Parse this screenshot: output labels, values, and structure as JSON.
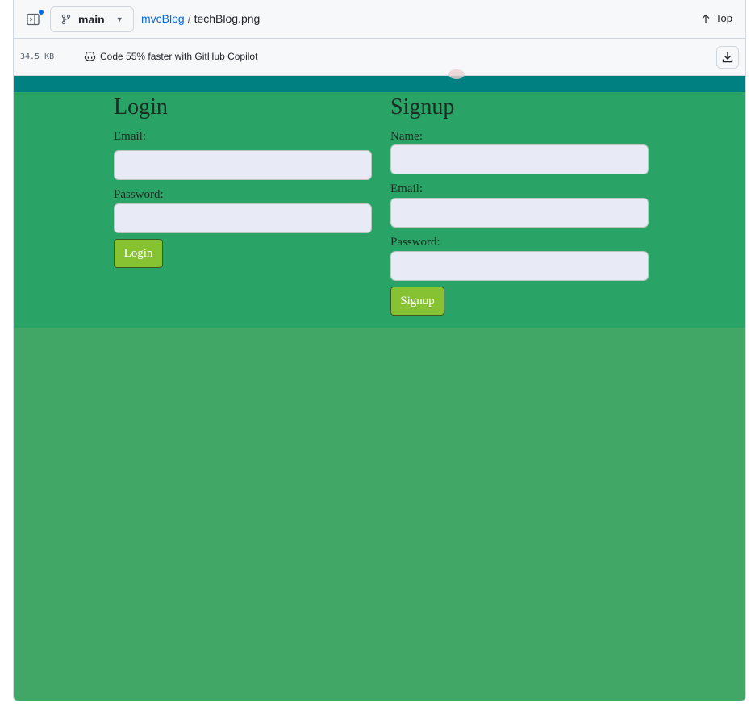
{
  "toolbar": {
    "branch": "main",
    "breadcrumb": {
      "repo": "mvcBlog",
      "separator": "/",
      "file": "techBlog.png"
    },
    "top_label": "Top"
  },
  "infobar": {
    "file_size": "34.5 KB",
    "copilot_text": "Code 55% faster with GitHub Copilot"
  },
  "image": {
    "login": {
      "title": "Login",
      "email_label": "Email:",
      "password_label": "Password:",
      "button": "Login"
    },
    "signup": {
      "title": "Signup",
      "name_label": "Name:",
      "email_label": "Email:",
      "password_label": "Password:",
      "button": "Signup"
    }
  },
  "colors": {
    "link": "#0969da",
    "teal_header": "#008080",
    "form_bg": "#2aa466",
    "page_bg": "#40a766",
    "button": "#86c232",
    "input_bg": "#e8eaf6"
  }
}
